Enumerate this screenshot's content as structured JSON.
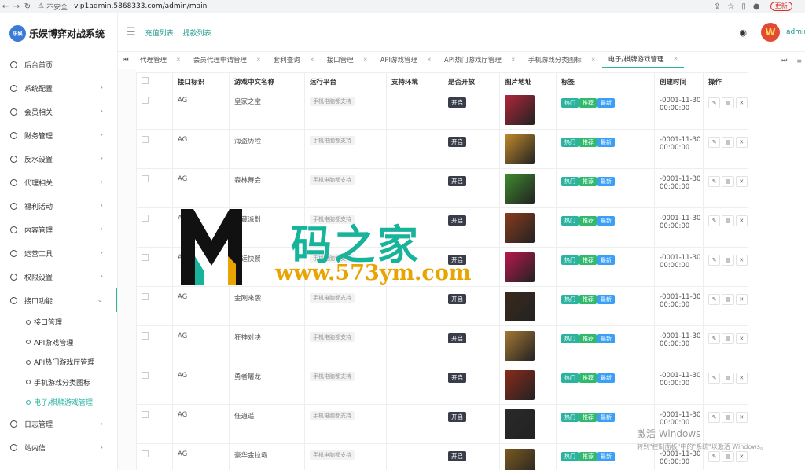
{
  "browser": {
    "insecure_label": "不安全",
    "url": "vip1admin.5868333.com/admin/main",
    "update_label": "更新"
  },
  "sidebar": {
    "brand_logo_text": "乐娱",
    "brand_name": "乐娱博弈对战系统",
    "items": [
      {
        "label": "后台首页",
        "arrow": false
      },
      {
        "label": "系统配置",
        "arrow": true
      },
      {
        "label": "会员相关",
        "arrow": true
      },
      {
        "label": "财务管理",
        "arrow": true
      },
      {
        "label": "反水设置",
        "arrow": true
      },
      {
        "label": "代理相关",
        "arrow": true
      },
      {
        "label": "福利活动",
        "arrow": true
      },
      {
        "label": "内容管理",
        "arrow": true
      },
      {
        "label": "运营工具",
        "arrow": true
      },
      {
        "label": "权限设置",
        "arrow": true
      },
      {
        "label": "接口功能",
        "arrow": true,
        "open": true
      }
    ],
    "subitems": [
      {
        "label": "接口管理"
      },
      {
        "label": "API游戏管理"
      },
      {
        "label": "API热门游戏厅管理"
      },
      {
        "label": "手机游戏分类图标"
      },
      {
        "label": "电子/棋牌游戏管理",
        "active": true
      }
    ],
    "bottom_items": [
      {
        "label": "日志管理",
        "arrow": true
      },
      {
        "label": "站内信",
        "arrow": true
      }
    ]
  },
  "header": {
    "links": [
      "充值列表",
      "提款列表"
    ],
    "username": "admin"
  },
  "tabs": [
    {
      "label": "代理管理"
    },
    {
      "label": "会员代理申请管理"
    },
    {
      "label": "套利查询"
    },
    {
      "label": "接口管理"
    },
    {
      "label": "API游戏管理"
    },
    {
      "label": "API热门游戏厅管理"
    },
    {
      "label": "手机游戏分类图标"
    },
    {
      "label": "电子/棋牌游戏管理",
      "active": true
    }
  ],
  "table": {
    "columns": [
      "接口标识",
      "游戏中文名称",
      "运行平台",
      "支持环境",
      "是否开放",
      "图片地址",
      "标签",
      "创建时间",
      "操作"
    ],
    "rows": [
      {
        "iface": "AG",
        "name": "皇家之宝",
        "platform": "手机电脑都支持",
        "env": "",
        "open": "开启",
        "tags": [
          "热门",
          "推荐",
          "最新"
        ],
        "created": "-0001-11-30 00:00:00",
        "thumb": "#b2263a"
      },
      {
        "iface": "AG",
        "name": "海盗历险",
        "platform": "手机电脑都支持",
        "env": "",
        "open": "开启",
        "tags": [
          "热门",
          "推荐",
          "最新"
        ],
        "created": "-0001-11-30 00:00:00",
        "thumb": "#c08a2a"
      },
      {
        "iface": "AG",
        "name": "森林舞会",
        "platform": "手机电脑都支持",
        "env": "",
        "open": "开启",
        "tags": [
          "热门",
          "推荐",
          "最新"
        ],
        "created": "-0001-11-30 00:00:00",
        "thumb": "#3f8b2e"
      },
      {
        "iface": "AG",
        "name": "寶藏派對",
        "platform": "手机电脑都支持",
        "env": "",
        "open": "开启",
        "tags": [
          "热门",
          "推荐",
          "最新"
        ],
        "created": "-0001-11-30 00:00:00",
        "thumb": "#8a3b1d"
      },
      {
        "iface": "AG",
        "name": "幸运快餐",
        "platform": "手机电脑都支持",
        "env": "",
        "open": "开启",
        "tags": [
          "热门",
          "推荐",
          "最新"
        ],
        "created": "-0001-11-30 00:00:00",
        "thumb": "#b8184e"
      },
      {
        "iface": "AG",
        "name": "金刚来袭",
        "platform": "手机电脑都支持",
        "env": "",
        "open": "开启",
        "tags": [
          "热门",
          "推荐",
          "最新"
        ],
        "created": "-0001-11-30 00:00:00",
        "thumb": "#3b2a1c"
      },
      {
        "iface": "AG",
        "name": "狂神对决",
        "platform": "手机电脑都支持",
        "env": "",
        "open": "开启",
        "tags": [
          "热门",
          "推荐",
          "最新"
        ],
        "created": "-0001-11-30 00:00:00",
        "thumb": "#a57834"
      },
      {
        "iface": "AG",
        "name": "勇者屠龙",
        "platform": "手机电脑都支持",
        "env": "",
        "open": "开启",
        "tags": [
          "热门",
          "推荐",
          "最新"
        ],
        "created": "-0001-11-30 00:00:00",
        "thumb": "#8b2a1a"
      },
      {
        "iface": "AG",
        "name": "任逍遥",
        "platform": "手机电脑都支持",
        "env": "",
        "open": "开启",
        "tags": [
          "热门",
          "推荐",
          "最新"
        ],
        "created": "-0001-11-30 00:00:00",
        "thumb": "#2a2a2a"
      },
      {
        "iface": "AG",
        "name": "豪华金拉霸",
        "platform": "手机电脑都支持",
        "env": "",
        "open": "开启",
        "tags": [
          "热门",
          "推荐",
          "最新"
        ],
        "created": "-0001-11-30 00:00:00",
        "thumb": "#7a5a20"
      }
    ]
  },
  "watermark": {
    "title": "码之家",
    "url": "www.573ym.com"
  },
  "activate": {
    "line1": "激活 Windows",
    "line2": "转到\"控制面板\"中的\"系统\"以激活 Windows。"
  }
}
